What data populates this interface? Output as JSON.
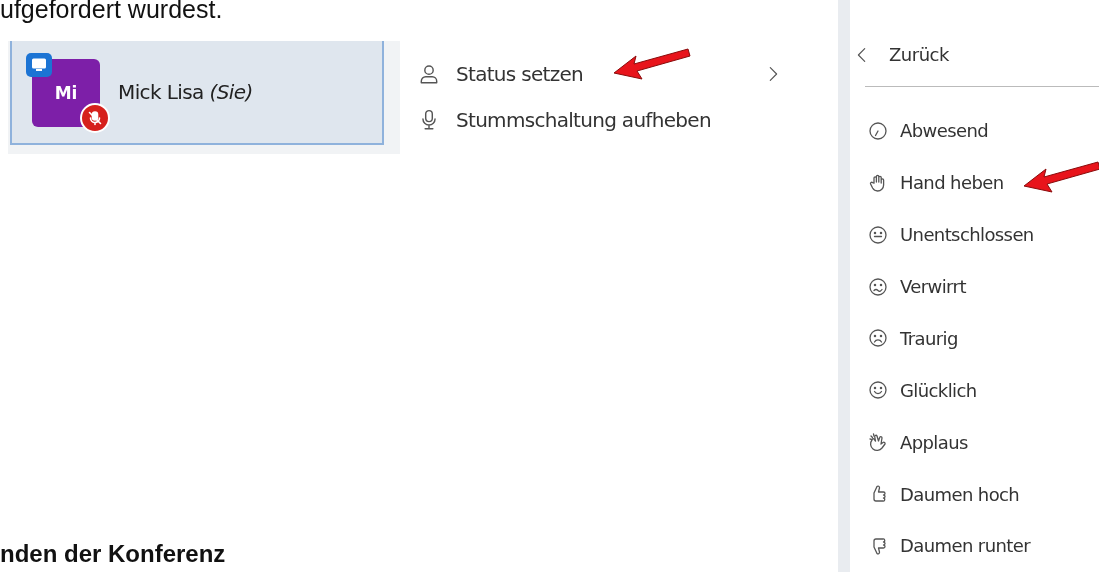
{
  "document": {
    "intro_text": "ufgefordert wurdest.",
    "heading": "nden der Konferenz"
  },
  "participant": {
    "initials": "Mi",
    "name": "Mick Lisa *(Sie)*",
    "muted": true,
    "selected": true
  },
  "context_menu": {
    "items": [
      {
        "kind": "submenu",
        "label": "Status setzen"
      },
      {
        "kind": "action",
        "label": "Stummschaltung aufheben"
      }
    ]
  },
  "status_menu": {
    "back_label": "Zurück",
    "items": [
      {
        "label": "Abwesend"
      },
      {
        "label": "Hand heben"
      },
      {
        "label": "Unentschlossen"
      },
      {
        "label": "Verwirrt"
      },
      {
        "label": "Traurig"
      },
      {
        "label": "Glücklich"
      },
      {
        "label": "Applaus"
      },
      {
        "label": "Daumen hoch"
      },
      {
        "label": "Daumen runter"
      }
    ]
  }
}
